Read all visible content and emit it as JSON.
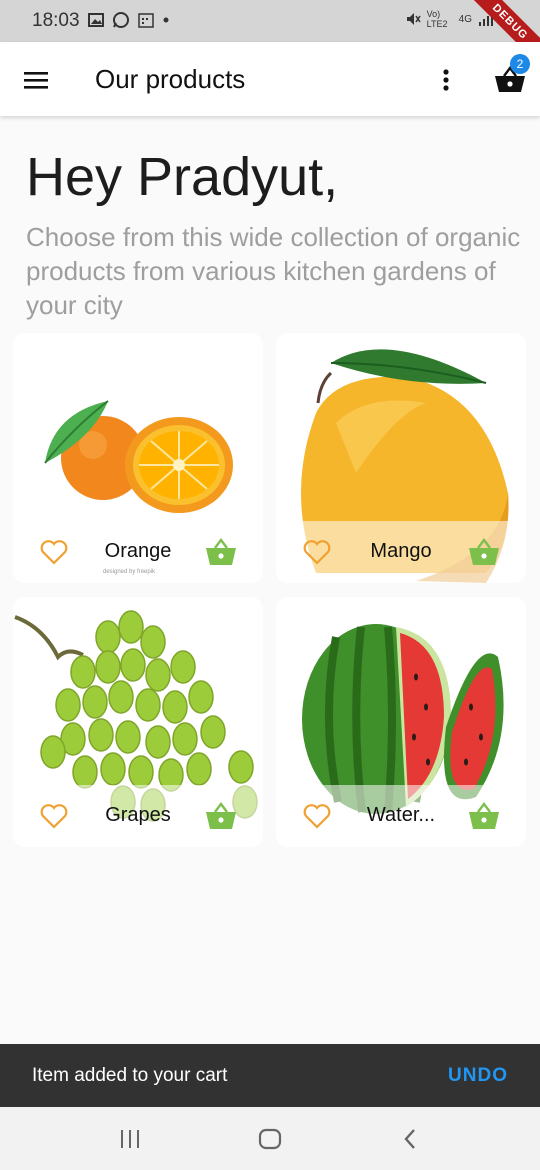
{
  "status_bar": {
    "time": "18:03",
    "network_label": "Vo) LTE2",
    "network_type": "4G",
    "debug_label": "DEBUG"
  },
  "app_bar": {
    "title": "Our products",
    "cart_count": "2"
  },
  "header": {
    "greeting": "Hey Pradyut,",
    "subtitle": "Choose from this wide collection of organic products from various kitchen gardens of your city"
  },
  "products": [
    {
      "name": "Orange",
      "credit": "designed by freepik"
    },
    {
      "name": "Mango"
    },
    {
      "name": "Grapes"
    },
    {
      "name": "Water..."
    }
  ],
  "snackbar": {
    "message": "Item added to your cart",
    "action": "UNDO"
  },
  "colors": {
    "accent_green": "#7cc04b",
    "favorite_orange": "#f0a030",
    "badge_blue": "#1e88e5",
    "snackbar_action": "#2196f3"
  }
}
